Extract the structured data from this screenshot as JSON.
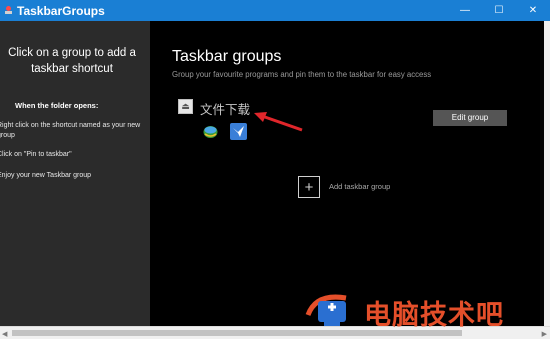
{
  "window": {
    "title": "TaskbarGroups",
    "controls": {
      "minimize": "—",
      "maximize": "☐",
      "close": "✕"
    }
  },
  "left_panel": {
    "heading": "Click on a group to add a taskbar shortcut",
    "sub_heading": "When the folder opens:",
    "steps": [
      "Right click on the shortcut named as your new group",
      "Click on \"Pin to taskbar\"",
      "Enjoy your new Taskbar group"
    ]
  },
  "main": {
    "title": "Taskbar groups",
    "subtitle": "Group your favourite programs and pin them to the taskbar for easy access",
    "group": {
      "name": "文件下载",
      "programs": [
        "internet-download-manager-icon",
        "bird-app-icon"
      ],
      "edit_label": "Edit group"
    },
    "add_label": "Add taskbar group"
  },
  "watermark": {
    "text": "电脑技术吧"
  },
  "colors": {
    "titlebar": "#1a7fd4",
    "left_panel_bg": "#2b2b2b",
    "main_bg": "#000000",
    "arrow": "#e0262b",
    "watermark": "#e54f2a"
  }
}
